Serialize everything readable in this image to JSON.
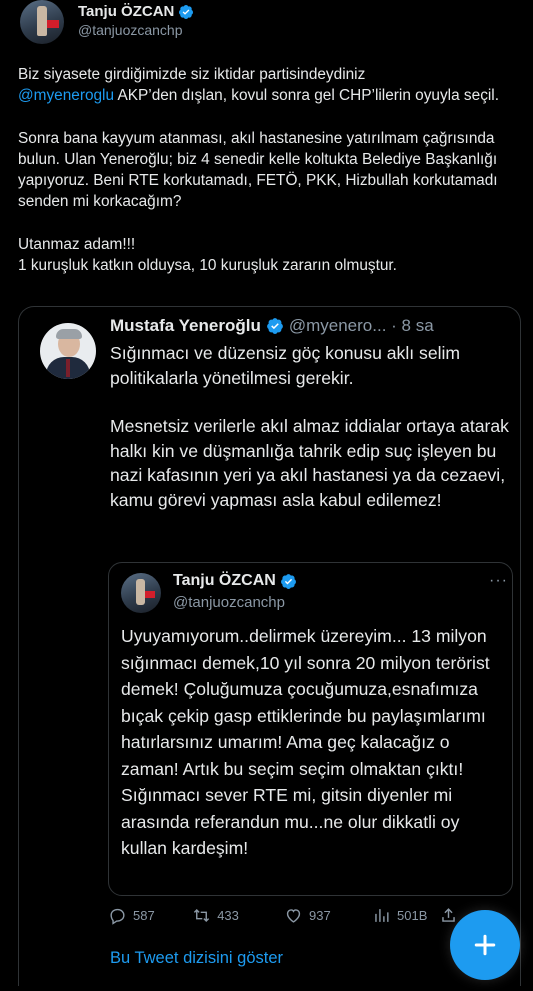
{
  "author": {
    "name": "Tanju ÖZCAN",
    "handle": "@tanjuozcanchp"
  },
  "tweet": {
    "p1_a": "Biz siyasete girdiğimizde siz iktidar partisindeydiniz",
    "p1_mention": "@myeneroglu",
    "p1_b": " AKP’den dışlan, kovul sonra gel CHP’lilerin oyuyla seçil.",
    "p2": "Sonra bana kayyum atanması, akıl hastanesine yatırılmam çağrısında bulun. Ulan Yeneroğlu; biz 4 senedir kelle koltukta Belediye Başkanlığı yapıyoruz. Beni RTE korkutamadı, FETÖ, PKK, Hizbullah korkutamadı senden mi korkacağım?",
    "p3_line1": "Utanmaz adam!!!",
    "p3_line2": "1 kuruşluk katkın olduysa, 10 kuruşluk zararın olmuştur."
  },
  "quote1": {
    "name": "Mustafa Yeneroğlu",
    "handle_time": "@myenero... · 8 sa",
    "p1": "Sığınmacı ve düzensiz göç konusu aklı selim politikalarla yönetilmesi gerekir.",
    "p2": "Mesnetsiz verilerle akıl almaz iddialar ortaya atarak halkı kin ve düşmanlığa tahrik edip suç işleyen bu nazi kafasının yeri ya akıl hastanesi ya da cezaevi, kamu görevi yapması asla kabul edilemez!"
  },
  "quote2": {
    "name": "Tanju ÖZCAN",
    "handle": "@tanjuozcanchp",
    "more": "···",
    "text": "Uyuyamıyorum..delirmek üzereyim... 13 milyon sığınmacı demek,10 yıl sonra 20 milyon terörist demek! Çoluğumuza çocuğumuza,esnafımıza bıçak çekip gasp ettiklerinde bu  paylaşımlarımı hatırlarsınız umarım! Ama geç kalacağız o zaman! Artık bu seçim seçim olmaktan çıktı! Sığınmacı sever RTE mi, gitsin diyenler mi arasında referandun mu...ne olur dikkatli oy kullan kardeşim!"
  },
  "actions": {
    "replies": "587",
    "retweets": "433",
    "likes": "937",
    "views": "501B"
  },
  "show_thread": "Bu Tweet dizisini göster",
  "colors": {
    "background": "#000000",
    "accent": "#1d9bf0",
    "text": "#e7e9ea",
    "secondary": "#8b98a5"
  },
  "icons": [
    "verified-badge-icon",
    "reply-icon",
    "retweet-icon",
    "like-icon",
    "views-icon",
    "share-icon",
    "compose-plus-icon"
  ]
}
